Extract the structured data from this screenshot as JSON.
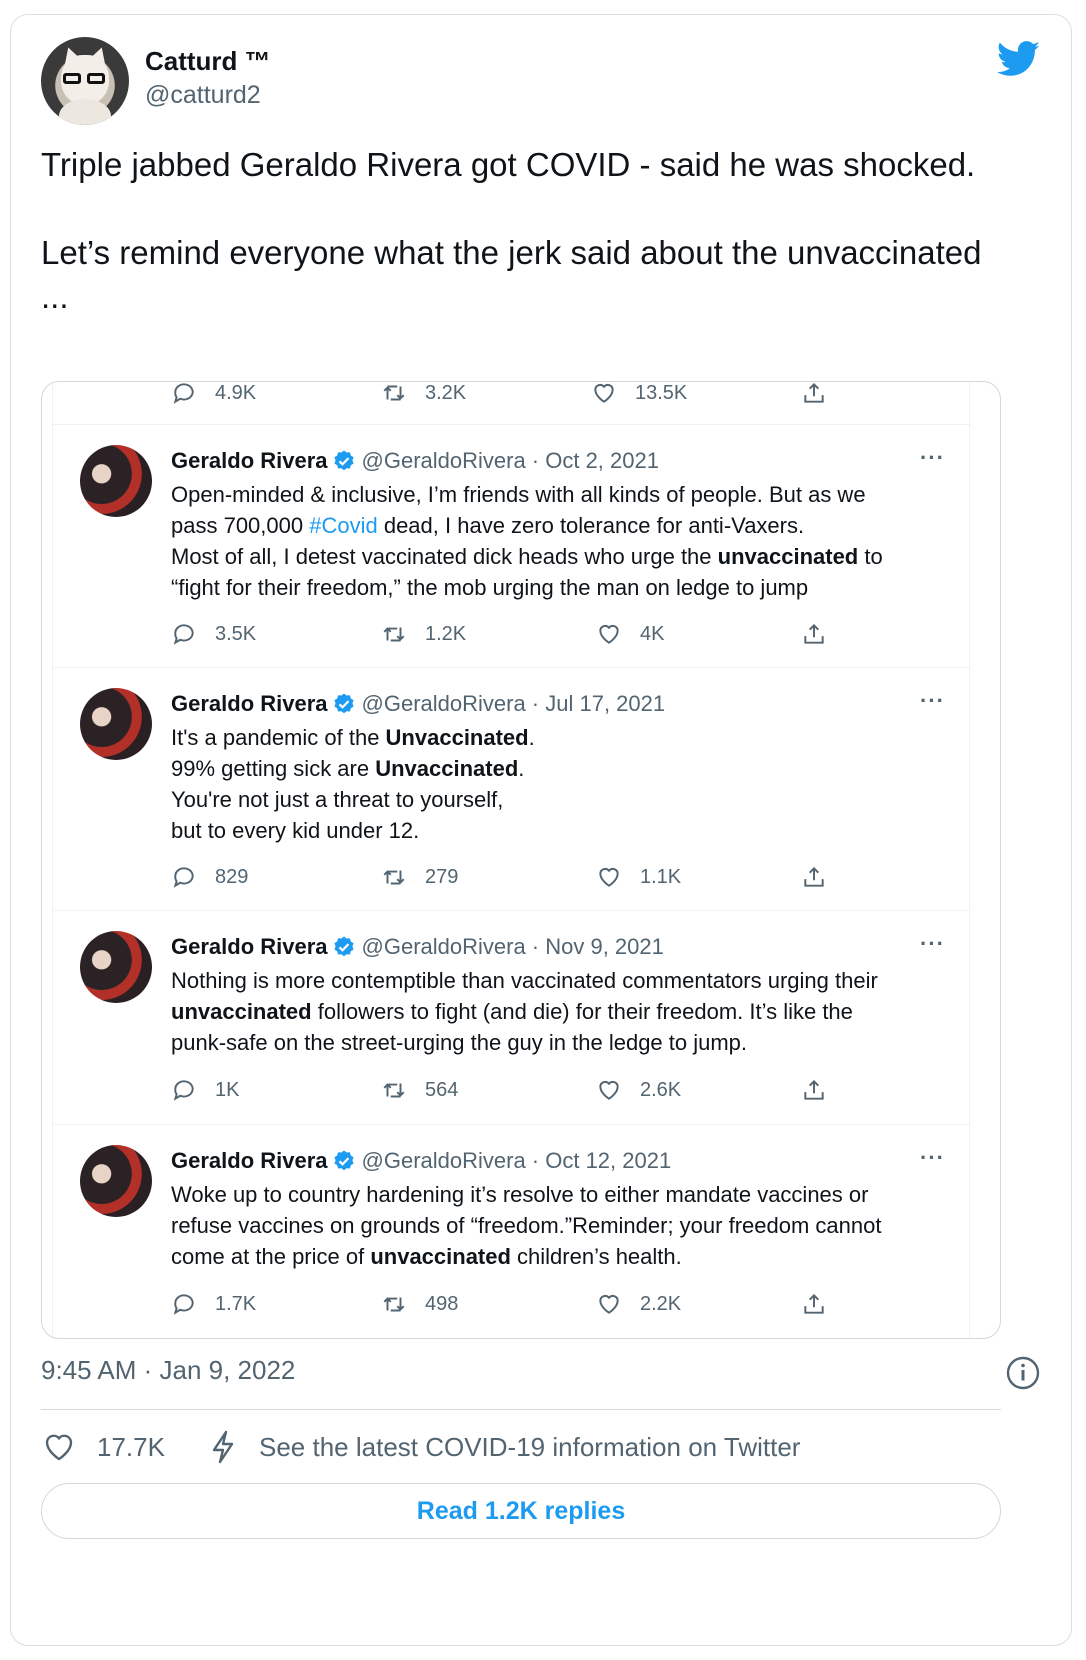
{
  "author": {
    "display_name": "Catturd ™",
    "handle": "@catturd2"
  },
  "tweet": {
    "text": "Triple jabbed Geraldo Rivera got COVID - said he was shocked.\n\nLet’s remind everyone what the jerk said about the unvaccinated ..."
  },
  "embedded": {
    "top_actions": {
      "replies": "4.9K",
      "retweets": "3.2K",
      "likes": "13.5K"
    },
    "tweets": [
      {
        "name": "Geraldo Rivera",
        "handle_date": "@GeraldoRivera · Oct 2, 2021",
        "more": "···",
        "lines": [
          [
            "Open-minded & inclusive, I’m friends with all kinds of people. But as we"
          ],
          [
            "pass 700,000 ",
            "#Covid",
            " dead, I have zero tolerance for anti-Vaxers."
          ],
          [
            "Most of all, I detest vaccinated dick heads who urge the ",
            "unvaccinated",
            " to"
          ],
          [
            "“fight for their freedom,” the mob urging the man on ledge to jump"
          ]
        ],
        "replies": "3.5K",
        "retweets": "1.2K",
        "likes": "4K"
      },
      {
        "name": "Geraldo Rivera",
        "handle_date": "@GeraldoRivera · Jul 17, 2021",
        "more": "···",
        "lines": [
          [
            "It's a pandemic of the ",
            "Unvaccinated",
            "."
          ],
          [
            "99% getting sick are ",
            "Unvaccinated",
            "."
          ],
          [
            "You're not just a threat to yourself,"
          ],
          [
            "but to every kid under 12."
          ]
        ],
        "replies": "829",
        "retweets": "279",
        "likes": "1.1K"
      },
      {
        "name": "Geraldo Rivera",
        "handle_date": "@GeraldoRivera · Nov 9, 2021",
        "more": "···",
        "lines": [
          [
            "Nothing is more contemptible than vaccinated commentators urging their"
          ],
          [
            "",
            "unvaccinated",
            " followers to fight (and die) for their freedom. It’s like the"
          ],
          [
            "punk-safe on the street-urging the guy in the ledge to jump."
          ]
        ],
        "replies": "1K",
        "retweets": "564",
        "likes": "2.6K"
      },
      {
        "name": "Geraldo Rivera",
        "handle_date": "@GeraldoRivera · Oct 12, 2021",
        "more": "···",
        "lines": [
          [
            "Woke up to country hardening it’s resolve to either mandate vaccines or"
          ],
          [
            "refuse vaccines on grounds of “freedom.”Reminder; your freedom cannot"
          ],
          [
            "come at the price of ",
            "unvaccinated",
            " children’s health."
          ]
        ],
        "replies": "1.7K",
        "retweets": "498",
        "likes": "2.2K"
      }
    ]
  },
  "footer": {
    "timestamp": "9:45 AM · Jan 9, 2022",
    "likes": "17.7K",
    "covid_info": "See the latest COVID-19 information on Twitter",
    "read_replies": "Read 1.2K replies"
  },
  "icons": {
    "brand": "twitter-bird-icon",
    "info": "info-icon",
    "like": "heart-icon",
    "reply": "reply-bubble-icon",
    "retweet": "retweet-icon",
    "share": "share-icon",
    "verified": "verified-badge-icon",
    "covid": "lightning-bolt-icon"
  },
  "colors": {
    "accent": "#1d9bf0",
    "muted_text": "#536471",
    "text": "#0f1419",
    "border": "#cfd9de"
  }
}
